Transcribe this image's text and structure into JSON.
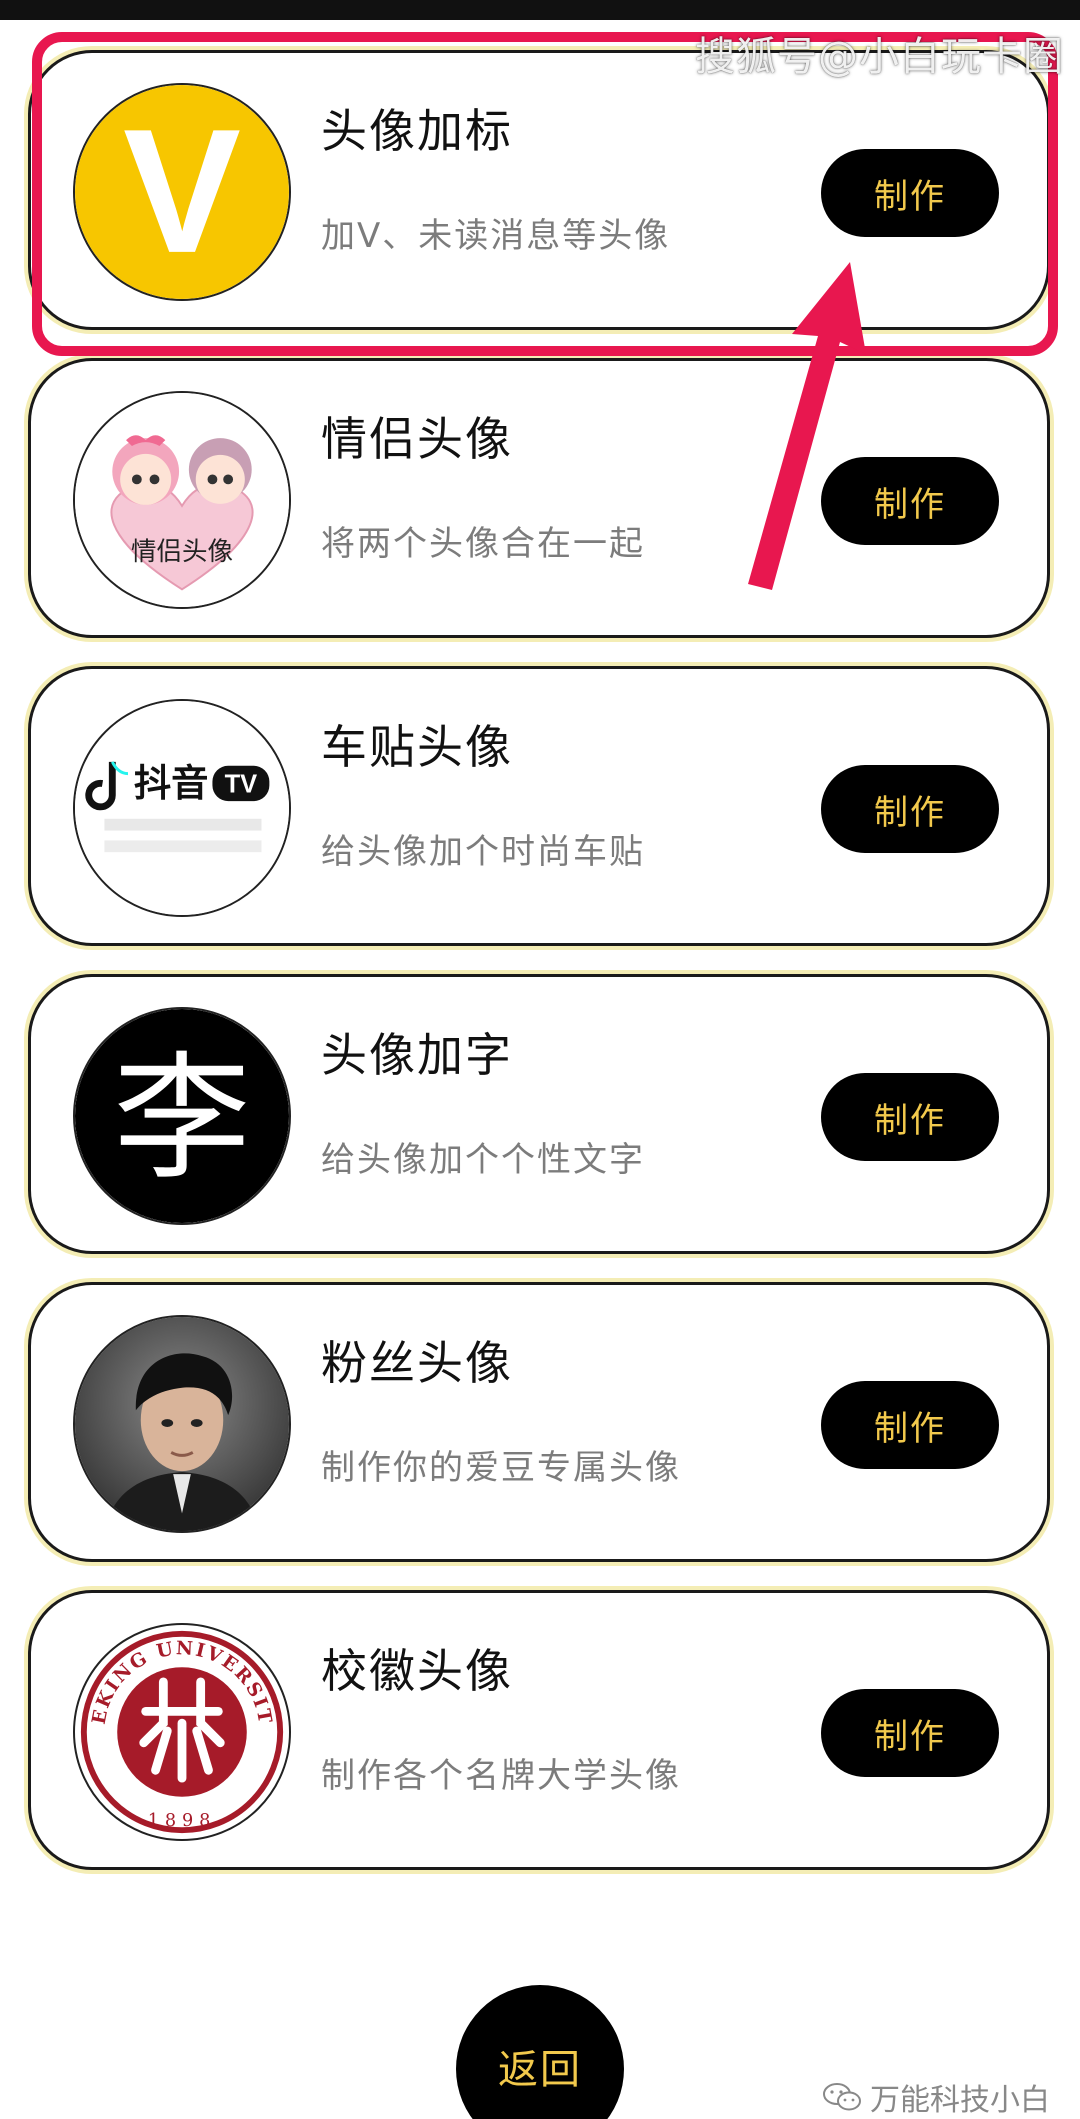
{
  "watermark_top": "搜狐号@小白玩卡圈",
  "cards": [
    {
      "title": "头像加标",
      "desc": "加V、未读消息等头像",
      "button": "制作",
      "avatar_icon": "v-badge-avatar",
      "avatar_text": "V"
    },
    {
      "title": "情侣头像",
      "desc": "将两个头像合在一起",
      "button": "制作",
      "avatar_icon": "couple-cartoon-avatar",
      "avatar_text": "情侣头像"
    },
    {
      "title": "车贴头像",
      "desc": "给头像加个时尚车贴",
      "button": "制作",
      "avatar_icon": "douyin-sticker-avatar",
      "avatar_text": "抖音"
    },
    {
      "title": "头像加字",
      "desc": "给头像加个个性文字",
      "button": "制作",
      "avatar_icon": "text-li-avatar",
      "avatar_text": "李"
    },
    {
      "title": "粉丝头像",
      "desc": "制作你的爱豆专属头像",
      "button": "制作",
      "avatar_icon": "idol-photo-avatar"
    },
    {
      "title": "校徽头像",
      "desc": "制作各个名牌大学头像",
      "button": "制作",
      "avatar_icon": "peking-university-seal-avatar",
      "avatar_text": "PEKING UNIVERSITY",
      "avatar_year": "1898"
    }
  ],
  "back_button": "返回",
  "watermark_bottom": "万能科技小白",
  "colors": {
    "accent_gold": "#f2c94c",
    "highlight_red": "#e8174f",
    "card_border": "#1a1a1a"
  }
}
